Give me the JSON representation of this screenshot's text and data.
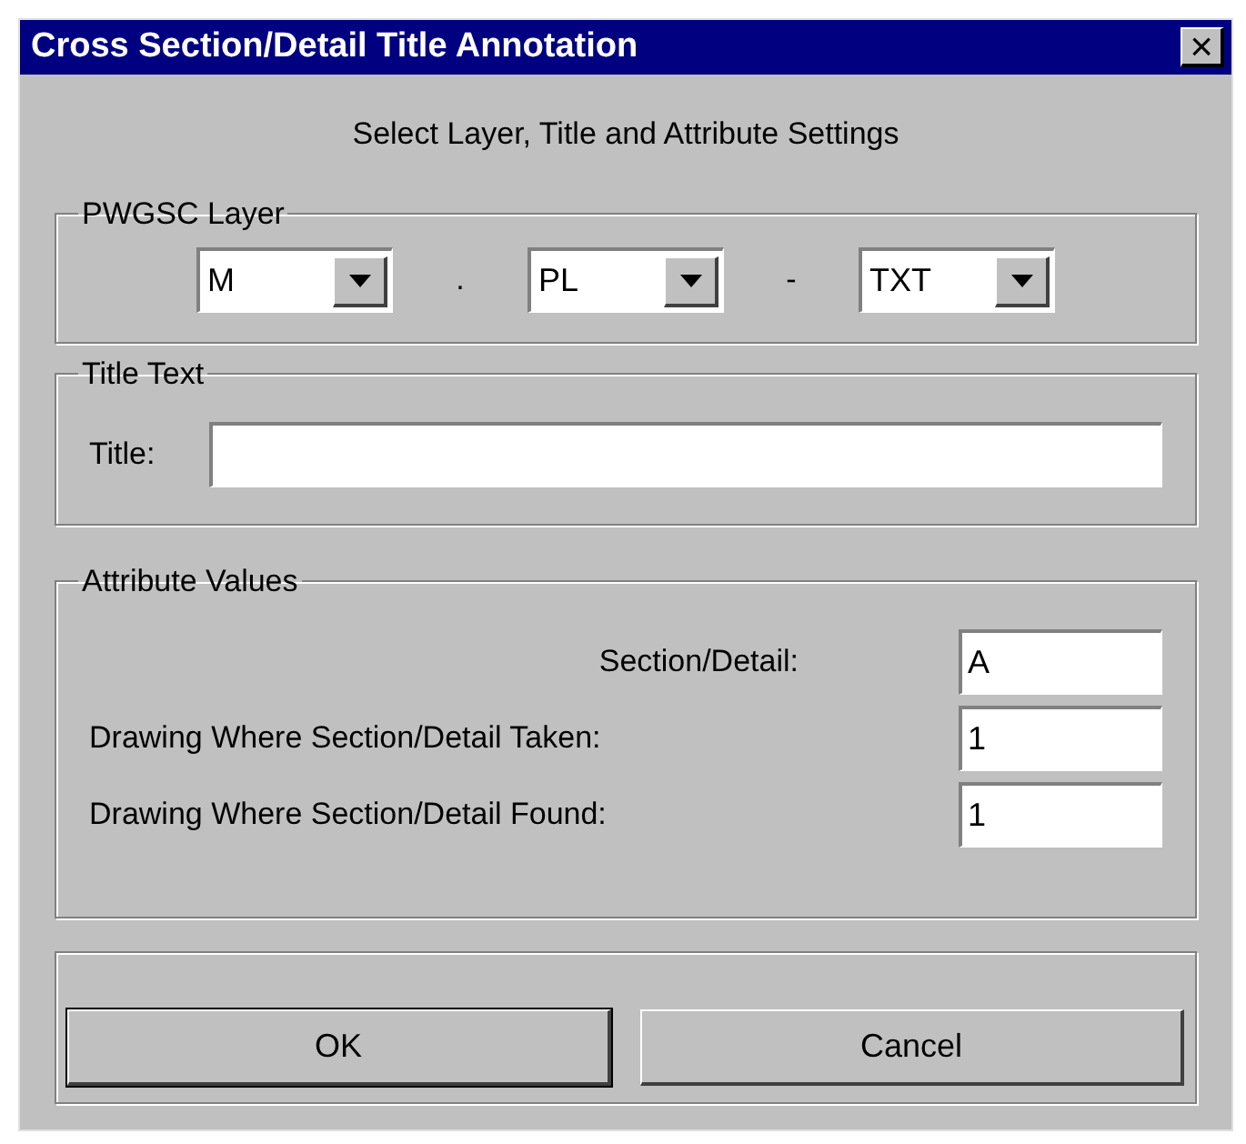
{
  "window": {
    "title": "Cross Section/Detail Title Annotation",
    "close": "×"
  },
  "instruction": "Select Layer, Title and Attribute Settings",
  "layer_group": {
    "label": "PWGSC Layer",
    "dropdowns": [
      {
        "value": "M",
        "separator_after": "."
      },
      {
        "value": "PL",
        "separator_after": "-"
      },
      {
        "value": "TXT"
      }
    ]
  },
  "title_group": {
    "label": "Title Text",
    "field_label": "Title:"
  },
  "attribute_group": {
    "label": "Attribute Values",
    "fields": [
      {
        "label": "Section/Detail:",
        "value": "A",
        "kind": "indented"
      },
      {
        "label": "Drawing Where Section/Detail Taken:",
        "value": "1",
        "kind": "plain"
      },
      {
        "label": "Drawing Where Section/Detail Found:",
        "value": "1",
        "kind": "plain"
      }
    ]
  },
  "buttons": [
    {
      "label": "OK",
      "default": true
    },
    {
      "label": "Cancel",
      "default": false
    }
  ]
}
